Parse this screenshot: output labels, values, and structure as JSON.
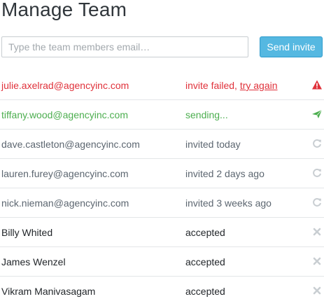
{
  "page": {
    "title": "Manage Team"
  },
  "invite": {
    "placeholder": "Type the team members email…",
    "value": "",
    "button_label": "Send invite"
  },
  "colors": {
    "error": "#e0323b",
    "success": "#4cae4f",
    "muted": "#5c6670",
    "accent": "#55b8e1"
  },
  "members": [
    {
      "name": "julie.axelrad@agencyinc.com",
      "status": "invite failed,",
      "link": "try again",
      "icon": "warning-icon",
      "state": "failed"
    },
    {
      "name": "tiffany.wood@agencyinc.com",
      "status": "sending...",
      "icon": "send-icon",
      "state": "sending"
    },
    {
      "name": "dave.castleton@agencyinc.com",
      "status": "invited today",
      "icon": "resend-icon",
      "state": "invited"
    },
    {
      "name": "lauren.furey@agencyinc.com",
      "status": "invited 2 days ago",
      "icon": "resend-icon",
      "state": "invited"
    },
    {
      "name": "nick.nieman@agencyinc.com",
      "status": "invited 3 weeks ago",
      "icon": "resend-icon",
      "state": "invited"
    },
    {
      "name": "Billy Whited",
      "status": "accepted",
      "icon": "remove-icon",
      "state": "accepted"
    },
    {
      "name": "James Wenzel",
      "status": "accepted",
      "icon": "remove-icon",
      "state": "accepted"
    },
    {
      "name": "Vikram Manivasagam",
      "status": "accepted",
      "icon": "remove-icon",
      "state": "accepted"
    }
  ]
}
